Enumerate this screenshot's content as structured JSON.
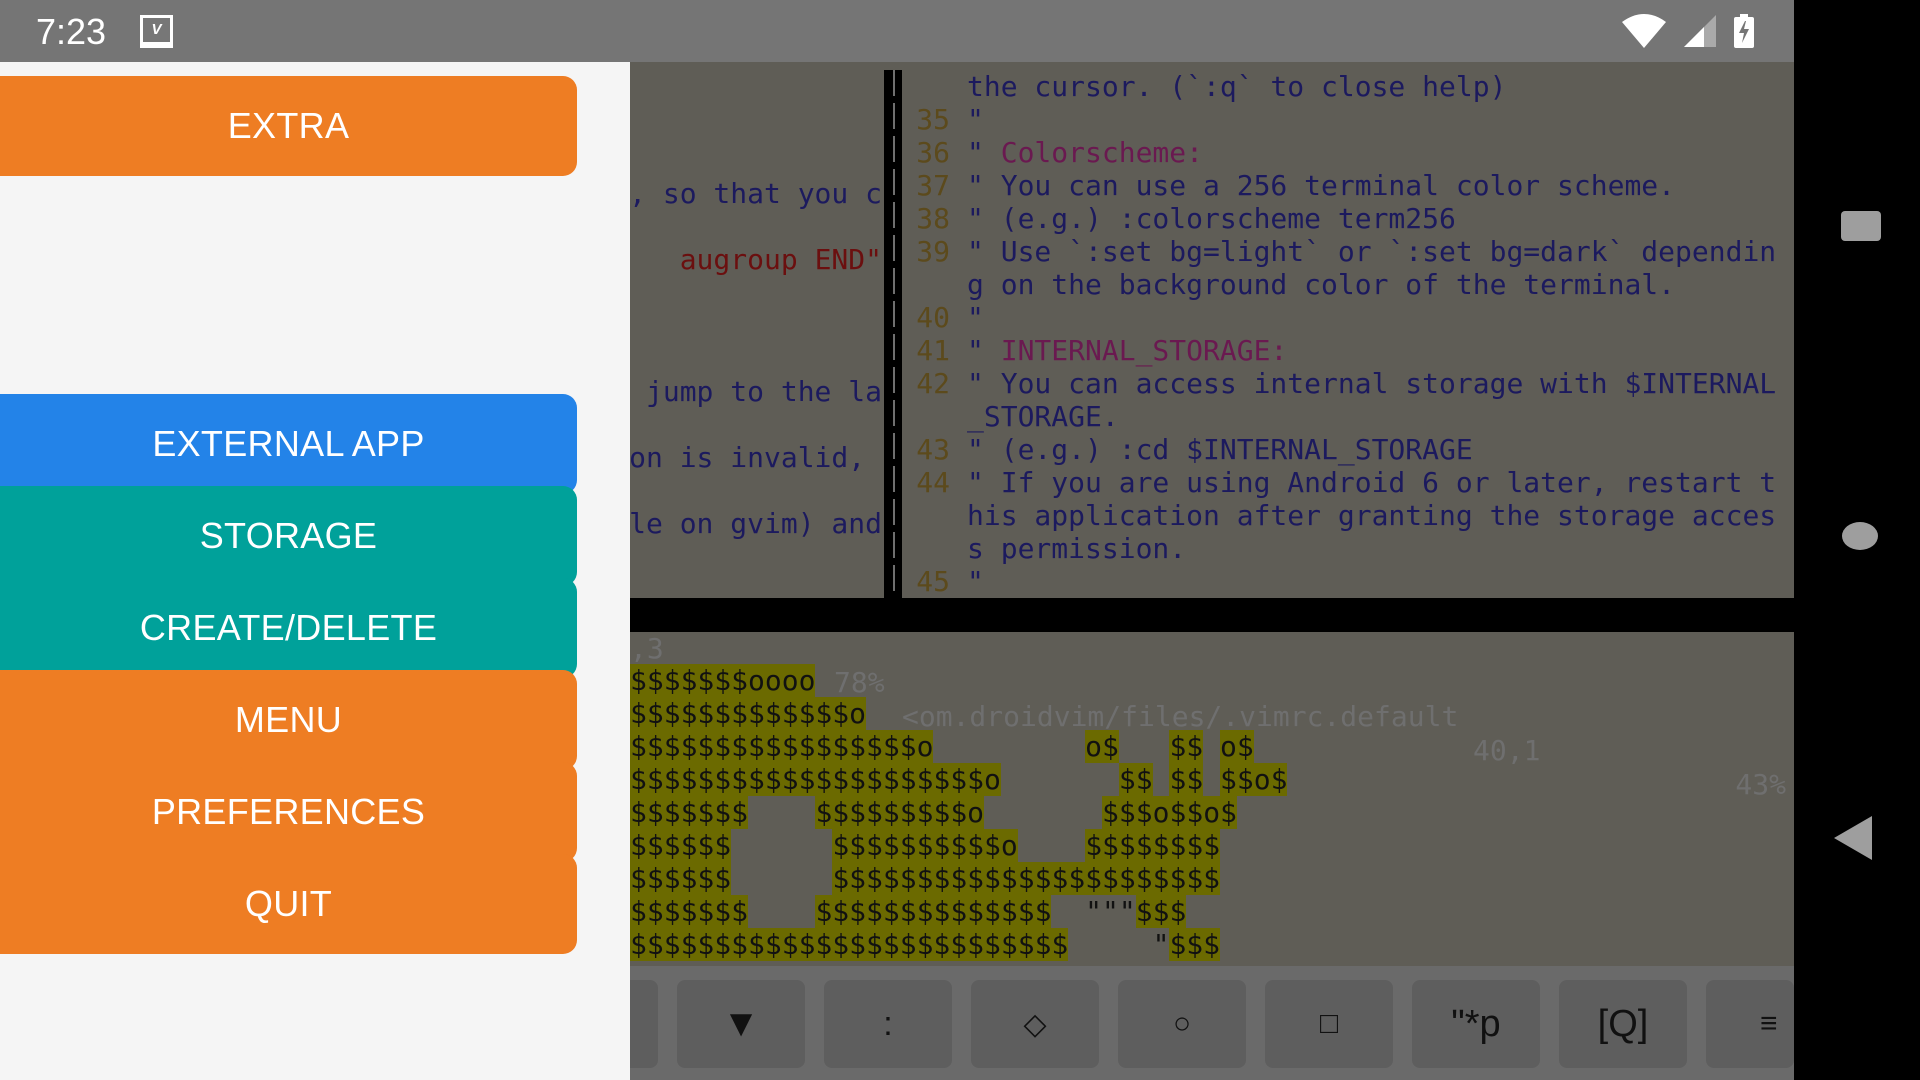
{
  "status_bar": {
    "time": "7:23",
    "notification_icon": "vim-app-icon",
    "notification_label": "Vim",
    "icons": [
      "wifi-icon",
      "cellular-signal-icon",
      "battery-charging-icon"
    ]
  },
  "drawer": {
    "buttons": [
      {
        "label": "EXTRA",
        "color": "#ee7d23"
      },
      {
        "label": "EXTERNAL APP",
        "color": "#2383e8"
      },
      {
        "label": "STORAGE",
        "color": "#00a19a"
      },
      {
        "label": "CREATE/DELETE",
        "color": "#00a19a"
      },
      {
        "label": "MENU",
        "color": "#ee7d23"
      },
      {
        "label": "PREFERENCES",
        "color": "#ee7d23"
      },
      {
        "label": "QUIT",
        "color": "#ee7d23"
      }
    ]
  },
  "vim": {
    "left_pane": {
      "lines": [
        {
          "row": 4,
          "text": ", so that you c",
          "color": "normal"
        },
        {
          "row": 6,
          "text": "augroup END\"",
          "color": "red"
        },
        {
          "row": 10,
          "text": " jump to the la",
          "color": "normal"
        },
        {
          "row": 12,
          "text": "on is invalid, ",
          "color": "normal"
        },
        {
          "row": 14,
          "text": "le on gvim) and",
          "color": "normal"
        }
      ],
      "status_position": ",3",
      "status_percent": "78%"
    },
    "right_pane": {
      "lines": [
        {
          "num": "",
          "text": "the cursor. (`:q` to close help)"
        },
        {
          "num": "35",
          "text": "\""
        },
        {
          "num": "36",
          "text": "\" ",
          "highlight": "Colorscheme:"
        },
        {
          "num": "37",
          "text": "\" You can use a 256 terminal color scheme."
        },
        {
          "num": "38",
          "text": "\" (e.g.) :colorscheme term256"
        },
        {
          "num": "39",
          "text": "\" Use `:set bg=light` or `:set bg=dark` dependin"
        },
        {
          "num": "",
          "text": "g on the background color of the terminal."
        },
        {
          "num": "40",
          "text": "\""
        },
        {
          "num": "41",
          "text": "\" ",
          "highlight": "INTERNAL_STORAGE:"
        },
        {
          "num": "42",
          "text": "\" You can access internal storage with $INTERNAL"
        },
        {
          "num": "",
          "text": "_STORAGE."
        },
        {
          "num": "43",
          "text": "\" (e.g.) :cd $INTERNAL_STORAGE"
        },
        {
          "num": "44",
          "text": "\" If you are using Android 6 or later, restart t"
        },
        {
          "num": "",
          "text": "his application after granting the storage acces"
        },
        {
          "num": "",
          "text": "s permission."
        },
        {
          "num": "45",
          "text": "\""
        }
      ],
      "status_file": "<om.droidvim/files/.vimrc.default",
      "status_position": "40,1",
      "status_percent": "43%"
    },
    "ascii_art": [
      [
        [
          "y",
          "$$$$$$$oooo"
        ]
      ],
      [
        [
          "y",
          "$$$$$$$$$$$$$o"
        ]
      ],
      [
        [
          "y",
          "$$$$$$$$$$$$$$$$$o"
        ],
        [
          "g",
          "         "
        ],
        [
          "y",
          "o$"
        ],
        [
          "g",
          "   "
        ],
        [
          "y",
          "$$"
        ],
        [
          "g",
          " "
        ],
        [
          "y",
          "o$"
        ]
      ],
      [
        [
          "y",
          "$$$$$$$$$$$$$$$$$$$$$o"
        ],
        [
          "g",
          "       "
        ],
        [
          "y",
          "$$"
        ],
        [
          "g",
          " "
        ],
        [
          "y",
          "$$"
        ],
        [
          "g",
          " "
        ],
        [
          "y",
          "$$o$"
        ]
      ],
      [
        [
          "y",
          "$$$$$$$"
        ],
        [
          "g",
          "    "
        ],
        [
          "y",
          "$$$$$$$$$o"
        ],
        [
          "g",
          "       "
        ],
        [
          "y",
          "$$$o$$o$"
        ]
      ],
      [
        [
          "y",
          "$$$$$$"
        ],
        [
          "g",
          "      "
        ],
        [
          "y",
          "$$$$$$$$$$o"
        ],
        [
          "g",
          "    "
        ],
        [
          "y",
          "$$$$$$$$"
        ]
      ],
      [
        [
          "y",
          "$$$$$$"
        ],
        [
          "g",
          "      "
        ],
        [
          "y",
          "$$$$$$$$$$$$$$$$$$$$$$$"
        ]
      ],
      [
        [
          "y",
          "$$$$$$$"
        ],
        [
          "g",
          "    "
        ],
        [
          "y",
          "$$$$$$$$$$$$$$"
        ],
        [
          "g",
          "  \"\"\""
        ],
        [
          "y",
          "$$$"
        ]
      ],
      [
        [
          "y",
          "$$$$$$$$$$$$$$$$$$$$$$$$$$"
        ],
        [
          "g",
          "     \""
        ],
        [
          "y",
          "$$$"
        ]
      ]
    ]
  },
  "extra_keys": [
    {
      "label": "",
      "icon": "partial-key"
    },
    {
      "label": "▼",
      "icon": "down-triangle-icon"
    },
    {
      "label": ":",
      "icon": "colon-key"
    },
    {
      "label": "◇",
      "icon": "diamond-icon"
    },
    {
      "label": "○",
      "icon": "circle-icon"
    },
    {
      "label": "□",
      "icon": "square-icon"
    },
    {
      "label": "\"*p",
      "icon": "paste-key"
    },
    {
      "label": "[Q]",
      "icon": "q-key"
    },
    {
      "label": "≡",
      "icon": "menu-icon"
    }
  ],
  "nav_bar": {
    "buttons": [
      "recents-button",
      "home-button",
      "back-button"
    ]
  }
}
